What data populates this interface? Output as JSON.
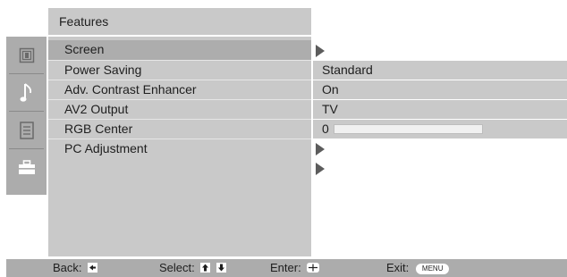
{
  "menu": {
    "title": "Features",
    "items": [
      {
        "label": "Screen"
      },
      {
        "label": "Power Saving"
      },
      {
        "label": "Adv. Contrast Enhancer"
      },
      {
        "label": "AV2 Output"
      },
      {
        "label": "RGB Center"
      },
      {
        "label": "PC Adjustment"
      }
    ]
  },
  "values": {
    "power_saving": "Standard",
    "adv_contrast": "On",
    "av2_output": "TV",
    "rgb_center": "0",
    "rgb_center_level": 0
  },
  "sidebar": {
    "icons": [
      "picture-icon",
      "sound-icon",
      "channel-list-icon",
      "toolbox-icon"
    ]
  },
  "statusbar": {
    "back": "Back:",
    "select": "Select:",
    "enter": "Enter:",
    "exit": "Exit:",
    "menu_key": "MENU"
  },
  "colors": {
    "panel": "#c9c9c9",
    "selected_row": "#adadad",
    "bar": "#acacac",
    "arrow": "#5c5c5c"
  }
}
